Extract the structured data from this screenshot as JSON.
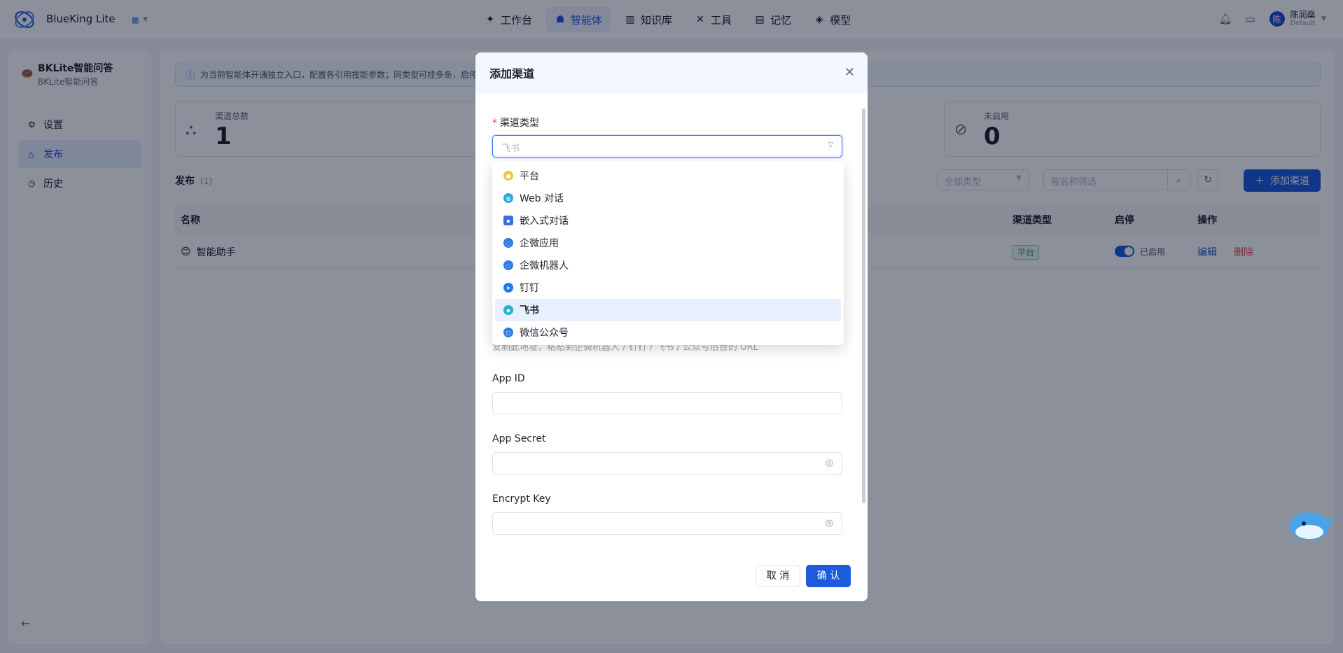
{
  "app": {
    "brand": "BlueKing Lite",
    "app_switch_icon": "grid-icon"
  },
  "nav": [
    {
      "label": "工作台",
      "icon": "workbench-icon"
    },
    {
      "label": "智能体",
      "icon": "agent-icon",
      "active": true
    },
    {
      "label": "知识库",
      "icon": "knowledge-icon"
    },
    {
      "label": "工具",
      "icon": "tools-icon"
    },
    {
      "label": "记忆",
      "icon": "memory-icon"
    },
    {
      "label": "模型",
      "icon": "model-icon"
    }
  ],
  "user": {
    "avatar": "陈",
    "name": "陈润燊",
    "tenant": "Default"
  },
  "sidebar": {
    "agent_name": "BKLite智能问答",
    "agent_sub": "BKLite智能问答",
    "items": [
      {
        "label": "设置",
        "icon": "gear-icon"
      },
      {
        "label": "发布",
        "icon": "publish-icon",
        "active": true
      },
      {
        "label": "历史",
        "icon": "history-icon"
      }
    ]
  },
  "main": {
    "banner": "为当前智能体开通独立入口，配置各引用技能参数；同类型可挂多条，启停",
    "stats": [
      {
        "label": "渠道总数",
        "value": "1"
      },
      {
        "label": "未启用",
        "value": "0"
      }
    ],
    "section_title": "发布",
    "section_count": "(1)",
    "filter_type": "全部类型",
    "filter_search_placeholder": "按名称筛选",
    "add_button": "添加渠道",
    "columns": {
      "name": "名称",
      "type": "渠道类型",
      "status": "启停",
      "action": "操作"
    },
    "rows": [
      {
        "name": "智能助手",
        "type": "平台",
        "status": "已启用",
        "edit": "编辑",
        "delete": "删除"
      }
    ]
  },
  "modal": {
    "title": "添加渠道",
    "channel_type_label": "渠道类型",
    "channel_type_value": "飞书",
    "hint": "复制此地址，粘贴到企微机器人 / 钉钉 / 飞书 / 公众号后台的 URL",
    "app_id_label": "App ID",
    "app_secret_label": "App Secret",
    "encrypt_key_label": "Encrypt Key",
    "cancel": "取 消",
    "confirm": "确 认"
  },
  "dropdown": {
    "options": [
      {
        "label": "平台",
        "color": "#f5c542",
        "icon": "platform-icon"
      },
      {
        "label": "Web 对话",
        "color": "#2aa9e0",
        "icon": "globe-icon"
      },
      {
        "label": "嵌入式对话",
        "color": "#3a6ee8",
        "icon": "chat-embed-icon"
      },
      {
        "label": "企微应用",
        "color": "#2d7be6",
        "icon": "wecom-app-icon"
      },
      {
        "label": "企微机器人",
        "color": "#2d7be6",
        "icon": "wecom-bot-icon"
      },
      {
        "label": "钉钉",
        "color": "#1f7bf2",
        "icon": "dingtalk-icon"
      },
      {
        "label": "飞书",
        "color": "#1fb6c9",
        "icon": "feishu-icon",
        "selected": true
      },
      {
        "label": "微信公众号",
        "color": "#2d7be6",
        "icon": "wechat-oa-icon"
      }
    ]
  }
}
